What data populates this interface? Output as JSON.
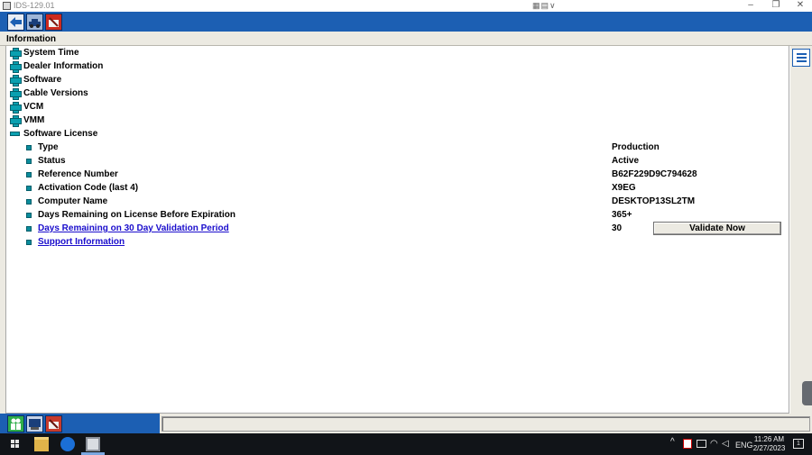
{
  "window": {
    "title": "IDS-129.01",
    "center_controls": "▦▤∨",
    "minimize": "–",
    "restore": "❐",
    "close": "✕"
  },
  "toolbar": {
    "buttons": [
      {
        "name": "back-arrow-icon"
      },
      {
        "name": "vehicle-icon"
      },
      {
        "name": "toolbox-icon"
      }
    ]
  },
  "header": {
    "title": "Information"
  },
  "tree": {
    "collapsed_sections": [
      "System Time",
      "Dealer Information",
      "Software",
      "Cable Versions",
      "VCM",
      "VMM"
    ],
    "expanded_section": "Software License",
    "items": [
      {
        "label": "Type",
        "value": "Production",
        "link": false
      },
      {
        "label": "Status",
        "value": "Active",
        "link": false
      },
      {
        "label": "Reference Number",
        "value": "B62F229D9C794628",
        "link": false
      },
      {
        "label": "Activation Code (last 4)",
        "value": "X9EG",
        "link": false
      },
      {
        "label": "Computer Name",
        "value": "DESKTOP13SL2TM",
        "link": false
      },
      {
        "label": "Days Remaining on License Before Expiration",
        "value": "365+",
        "link": false
      },
      {
        "label": "Days Remaining on 30 Day Validation Period",
        "value": "30",
        "link": true
      },
      {
        "label": "Support Information",
        "value": "",
        "link": true
      }
    ],
    "validate_button": "Validate Now"
  },
  "taskbar": {
    "lang": "ENG",
    "time": "11:26 AM",
    "date": "2/27/2023",
    "tray_chevron": "^",
    "notification_count": "1"
  },
  "colors": {
    "toolbar_blue": "#1c5fb3",
    "expander_teal": "#0aa0b0",
    "link_blue": "#1a0dcc",
    "panel_gray": "#eceae2"
  }
}
